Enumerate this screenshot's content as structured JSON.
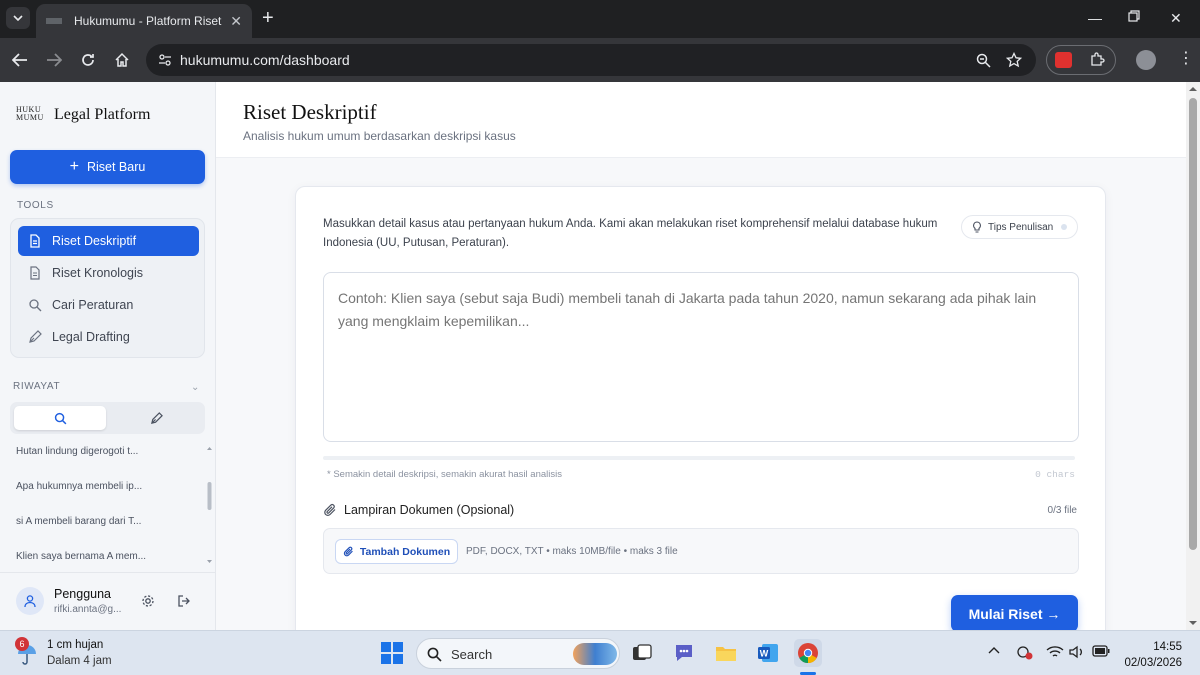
{
  "browser": {
    "tab_title": "Hukumumu - Platform Riset Hu",
    "url": "hukumumu.com/dashboard"
  },
  "sidebar": {
    "logo_mark_line1": "HUKU",
    "logo_mark_line2": "MUMU",
    "logo_text": "Legal Platform",
    "new_research_label": "Riset Baru",
    "tools_label": "TOOLS",
    "tools": [
      {
        "label": "Riset Deskriptif",
        "active": true
      },
      {
        "label": "Riset Kronologis",
        "active": false
      },
      {
        "label": "Cari Peraturan",
        "active": false
      },
      {
        "label": "Legal Drafting",
        "active": false
      }
    ],
    "history_label": "RIWAYAT",
    "history": [
      "Hutan lindung digerogoti t...",
      "Apa hukumnya membeli ip...",
      "si A membeli barang dari T...",
      "Klien saya bernama A mem..."
    ],
    "user": {
      "name": "Pengguna",
      "email": "rifki.annta@g..."
    }
  },
  "main": {
    "title": "Riset Deskriptif",
    "subtitle": "Analisis hukum umum berdasarkan deskripsi kasus",
    "intro": "Masukkan detail kasus atau pertanyaan hukum Anda. Kami akan melakukan riset komprehensif melalui database hukum Indonesia (UU, Putusan, Peraturan).",
    "tips_label": "Tips Penulisan",
    "textarea_placeholder": "Contoh: Klien saya (sebut saja Budi) membeli tanah di Jakarta pada tahun 2020, namun sekarang ada pihak lain yang mengklaim kepemilikan...",
    "textarea_value": "",
    "hint": "* Semakin detail deskripsi, semakin akurat hasil analisis",
    "char_count": "0 chars",
    "progress": 0,
    "attach_title": "Lampiran Dokumen (Opsional)",
    "attach_count": "0/3 file",
    "add_doc_label": "Tambah Dokumen",
    "formats": "PDF, DOCX, TXT • maks 10MB/file • maks 3 file",
    "start_label": "Mulai Riset →"
  },
  "taskbar": {
    "weather_badge": "6",
    "weather_line1": "1 cm hujan",
    "weather_line2": "Dalam 4 jam",
    "search_label": "Search",
    "time": "14:55",
    "date": "02/03/2026"
  },
  "colors": {
    "accent": "#1f5fe0",
    "browser_dark": "#35363a"
  }
}
